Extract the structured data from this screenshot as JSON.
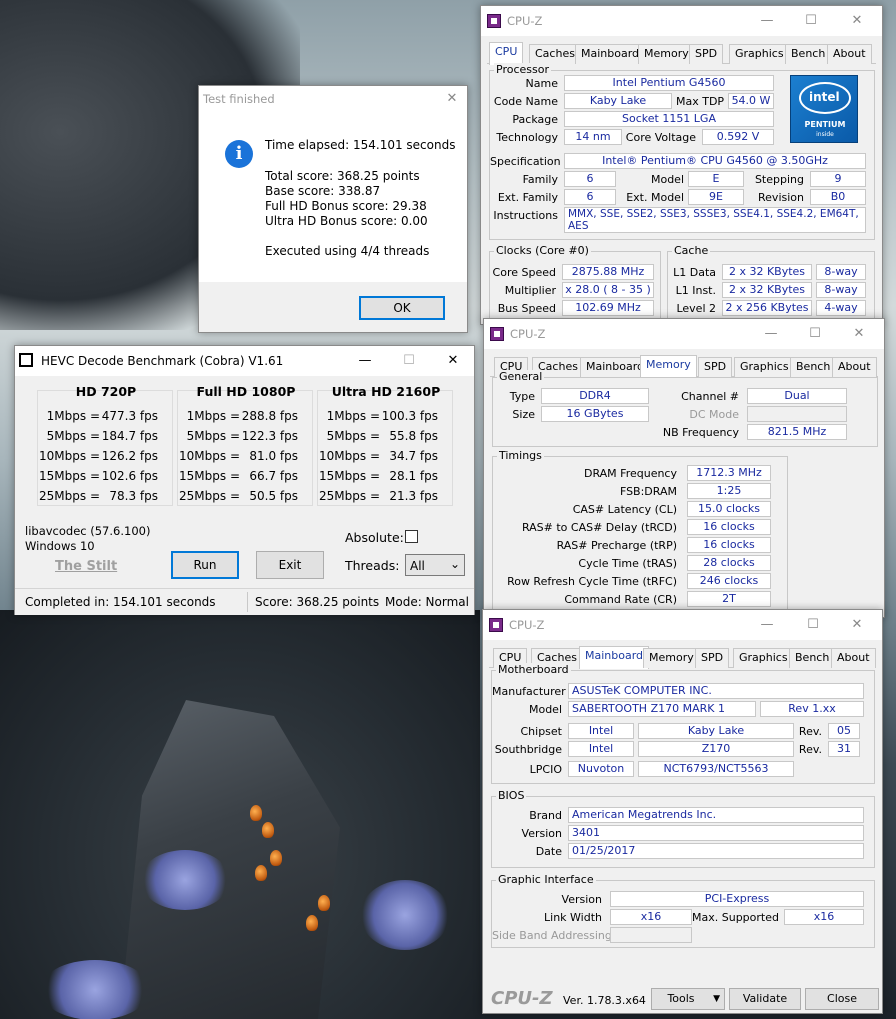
{
  "test_dialog": {
    "title": "Test finished",
    "time_elapsed": "Time elapsed:  154.101 seconds",
    "total_score": "Total score:  368.25 points",
    "base_score": "Base score: 338.87",
    "fullhd_bonus": "Full HD Bonus score: 29.38",
    "ultrahd_bonus": "Ultra HD Bonus score: 0.00",
    "threads": "Executed using 4/4 threads",
    "ok_label": "OK",
    "info_glyph": "i"
  },
  "hevc": {
    "title": "HEVC Decode Benchmark (Cobra) V1.61",
    "columns": [
      {
        "header": "HD 720P",
        "rows": [
          {
            "rate": "1Mbps =",
            "fps": "477.3 fps"
          },
          {
            "rate": "5Mbps =",
            "fps": "184.7 fps"
          },
          {
            "rate": "10Mbps =",
            "fps": "126.2 fps"
          },
          {
            "rate": "15Mbps =",
            "fps": "102.6 fps"
          },
          {
            "rate": "25Mbps =",
            "fps": "78.3 fps"
          }
        ]
      },
      {
        "header": "Full HD 1080P",
        "rows": [
          {
            "rate": "1Mbps =",
            "fps": "288.8 fps"
          },
          {
            "rate": "5Mbps =",
            "fps": "122.3 fps"
          },
          {
            "rate": "10Mbps =",
            "fps": "81.0 fps"
          },
          {
            "rate": "15Mbps =",
            "fps": "66.7 fps"
          },
          {
            "rate": "25Mbps =",
            "fps": "50.5 fps"
          }
        ]
      },
      {
        "header": "Ultra HD 2160P",
        "rows": [
          {
            "rate": "1Mbps =",
            "fps": "100.3 fps"
          },
          {
            "rate": "5Mbps =",
            "fps": "55.8 fps"
          },
          {
            "rate": "10Mbps =",
            "fps": "34.7 fps"
          },
          {
            "rate": "15Mbps =",
            "fps": "28.1 fps"
          },
          {
            "rate": "25Mbps =",
            "fps": "21.3 fps"
          }
        ]
      }
    ],
    "libav": "libavcodec (57.6.100)",
    "os": "Windows 10",
    "author": "The Stilt",
    "run_label": "Run",
    "exit_label": "Exit",
    "absolute_label": "Absolute:",
    "threads_label": "Threads:",
    "threads_value": "All",
    "status_completed": "Completed in: 154.101 seconds",
    "status_score": "Score: 368.25 points",
    "status_mode": "Mode: Normal"
  },
  "cpuz_tabs": [
    "CPU",
    "Caches",
    "Mainboard",
    "Memory",
    "SPD",
    "Graphics",
    "Bench",
    "About"
  ],
  "cpuz_cpu": {
    "title": "CPU-Z",
    "processor_label": "Processor",
    "name_label": "Name",
    "name": "Intel Pentium G4560",
    "codename_label": "Code Name",
    "codename": "Kaby Lake",
    "maxtdp_label": "Max TDP",
    "maxtdp": "54.0 W",
    "package_label": "Package",
    "package": "Socket 1151 LGA",
    "technology_label": "Technology",
    "technology": "14 nm",
    "corevoltage_label": "Core Voltage",
    "corevoltage": "0.592 V",
    "spec_label": "Specification",
    "spec": "Intel® Pentium® CPU G4560 @ 3.50GHz",
    "family_label": "Family",
    "family": "6",
    "model_label": "Model",
    "model": "E",
    "stepping_label": "Stepping",
    "stepping": "9",
    "extfamily_label": "Ext. Family",
    "extfamily": "6",
    "extmodel_label": "Ext. Model",
    "extmodel": "9E",
    "revision_label": "Revision",
    "revision": "B0",
    "instructions_label": "Instructions",
    "instructions": "MMX, SSE, SSE2, SSE3, SSSE3, SSE4.1, SSE4.2, EM64T, AES",
    "clocks_label": "Clocks (Core #0)",
    "corespeed_label": "Core Speed",
    "corespeed": "2875.88 MHz",
    "multiplier_label": "Multiplier",
    "multiplier": "x 28.0 ( 8 - 35 )",
    "busspeed_label": "Bus Speed",
    "busspeed": "102.69 MHz",
    "cache_label": "Cache",
    "l1data_label": "L1 Data",
    "l1data": "2 x 32 KBytes",
    "l1data_way": "8-way",
    "l1inst_label": "L1 Inst.",
    "l1inst": "2 x 32 KBytes",
    "l1inst_way": "8-way",
    "level2_label": "Level 2",
    "level2": "2 x 256 KBytes",
    "level2_way": "4-way",
    "logo": {
      "brand": "intel",
      "product": "PENTIUM",
      "tag": "inside"
    }
  },
  "cpuz_mem": {
    "title": "CPU-Z",
    "general_label": "General",
    "type_label": "Type",
    "type": "DDR4",
    "channel_label": "Channel #",
    "channel": "Dual",
    "size_label": "Size",
    "size": "16 GBytes",
    "dcmode_label": "DC Mode",
    "nbfreq_label": "NB Frequency",
    "nbfreq": "821.5 MHz",
    "timings_label": "Timings",
    "timings": [
      {
        "label": "DRAM Frequency",
        "value": "1712.3 MHz"
      },
      {
        "label": "FSB:DRAM",
        "value": "1:25"
      },
      {
        "label": "CAS# Latency (CL)",
        "value": "15.0 clocks"
      },
      {
        "label": "RAS# to CAS# Delay (tRCD)",
        "value": "16 clocks"
      },
      {
        "label": "RAS# Precharge (tRP)",
        "value": "16 clocks"
      },
      {
        "label": "Cycle Time (tRAS)",
        "value": "28 clocks"
      },
      {
        "label": "Row Refresh Cycle Time (tRFC)",
        "value": "246 clocks"
      },
      {
        "label": "Command Rate (CR)",
        "value": "2T"
      }
    ]
  },
  "cpuz_mb": {
    "title": "CPU-Z",
    "motherboard_label": "Motherboard",
    "manufacturer_label": "Manufacturer",
    "manufacturer": "ASUSTeK COMPUTER INC.",
    "model_label": "Model",
    "model": "SABERTOOTH Z170 MARK 1",
    "model_rev": "Rev 1.xx",
    "chipset_label": "Chipset",
    "chipset_vendor": "Intel",
    "chipset": "Kaby Lake",
    "chipset_rev_label": "Rev.",
    "chipset_rev": "05",
    "southbridge_label": "Southbridge",
    "sb_vendor": "Intel",
    "sb": "Z170",
    "sb_rev_label": "Rev.",
    "sb_rev": "31",
    "lpcio_label": "LPCIO",
    "lpcio_vendor": "Nuvoton",
    "lpcio": "NCT6793/NCT5563",
    "bios_label": "BIOS",
    "brand_label": "Brand",
    "brand": "American Megatrends Inc.",
    "version_label": "Version",
    "version": "3401",
    "date_label": "Date",
    "date": "01/25/2017",
    "gi_label": "Graphic Interface",
    "gi_version_label": "Version",
    "gi_version": "PCI-Express",
    "linkwidth_label": "Link Width",
    "linkwidth": "x16",
    "maxsupported_label": "Max. Supported",
    "maxsupported": "x16",
    "sideband_label": "Side Band Addressing",
    "footer_brand": "CPU-Z",
    "footer_version": "Ver. 1.78.3.x64",
    "tools_label": "Tools",
    "validate_label": "Validate",
    "close_label": "Close"
  },
  "colors": {
    "value_text": "#1a2aa0",
    "active_tab": "#1a3aa0",
    "info_icon": "#1a73d9",
    "focus_border": "#0078d7"
  }
}
